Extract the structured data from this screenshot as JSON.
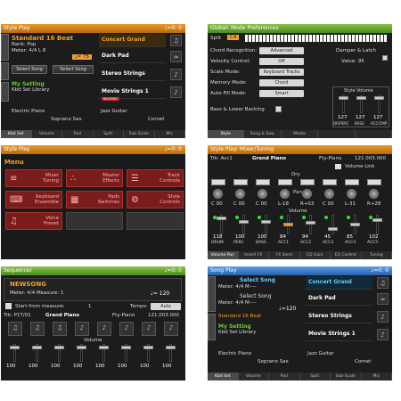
{
  "p1": {
    "header_left": "Style Play",
    "header_right": "♩=0: 0",
    "style_name": "Standard 16 Beat",
    "style_sub": "Bank: Pop",
    "meter": "Meter: 4/4 L  8",
    "tempo": "♩= 75",
    "select_song_1": "Select Song",
    "select_song_2": "Select Song",
    "my_setting": "My Setting",
    "kbd_lib": "Kbd Set Library",
    "sounds": [
      "Concert Grand",
      "Dark Pad",
      "Stereo Strings",
      "Movie Strings 1"
    ],
    "backing_badge": "BACKING",
    "bottom_labels": [
      "Electric Piano",
      "Jazz Guitar",
      "Soprano Sax",
      "Cornet"
    ],
    "tabs": [
      "Kbd Set",
      "Volume",
      "Pad",
      "Split",
      "Sub-Scale",
      "Mic"
    ]
  },
  "p2": {
    "header_left": "Global: Mode Preferences",
    "split_label": "Split",
    "split_value": "C4",
    "rows": [
      {
        "label": "Chord Recognition:",
        "value": "Advanced"
      },
      {
        "label": "Velocity Control:",
        "value": "Off"
      },
      {
        "label": "Scale Mode:",
        "value": "Keyboard Tracks"
      },
      {
        "label": "Memory Mode:",
        "value": "Chord"
      },
      {
        "label": "Auto Fill Mode:",
        "value": "Smart"
      }
    ],
    "damper": "Damper & Latch",
    "value_label": "Value: 95",
    "bass_lower": "Bass & Lower Backing",
    "style_volume": "Style Volume",
    "vol_values": [
      "127",
      "127",
      "127"
    ],
    "vol_labels": [
      "DR/PERC",
      "BASS",
      "ACC/CMP"
    ],
    "tabs": [
      "Style",
      "Song & Seq.",
      "Media"
    ]
  },
  "p3": {
    "header_left": "Style Play",
    "header_right": "♩=0: 0",
    "menu_title": "Menu",
    "items": [
      "Mixer Tuning",
      "Master Effects",
      "Track Controls",
      "Keyboard Ensemble",
      "Pads Switches",
      "Style Controls",
      "Voice Preset"
    ]
  },
  "p4": {
    "header_left": "Style Play: Mixer/Tuning",
    "trk": "Trk: Acc1",
    "sound": "Grand Piano",
    "bank": "Fty-Piano",
    "num": "121.003.000",
    "volume_link": "Volume Link",
    "drys": [
      "Dry",
      "Pan",
      "Volume"
    ],
    "pan_values": [
      "C 00",
      "C 00",
      "C 00",
      "L-18",
      "R+03",
      "C 00",
      "L-31",
      "R+28"
    ],
    "volumes": [
      "118",
      "100",
      "100",
      "84",
      "94",
      "45",
      "85",
      "102"
    ],
    "channels": [
      "DRUM",
      "PERC",
      "BASS",
      "ACC1",
      "ACC2",
      "ACC3",
      "ACC4",
      "ACC5"
    ],
    "tabs": [
      "Volume Pan",
      "Insert FX",
      "FX Send",
      "EQ Gain",
      "EQ Control",
      "Tuning"
    ]
  },
  "p5": {
    "header_left": "Sequencer",
    "header_right": "♩=0: 0",
    "song_name": "NEWSONG",
    "meter": "Meter: 4/4   Measure:  1",
    "tempo_display": "♩= 120",
    "start_from": "Start from measure:",
    "start_val": "1",
    "tempo_label": "Tempo:",
    "tempo_mode": "Auto",
    "trk": "Trk: P1T/01",
    "sound": "Grand Piano",
    "bank": "Fty-Piano",
    "num": "121.003.000",
    "volume": "Volume",
    "vol_values": [
      "100",
      "100",
      "100",
      "100",
      "100",
      "100",
      "100",
      "100"
    ]
  },
  "p6": {
    "header_left": "Song Play",
    "header_right": "♩=0: 0",
    "select_song_1": "Select Song",
    "meter1": "Meter: 4/4   M----",
    "select_song_2": "Select Song",
    "meter2": "Meter: 4/4   M----",
    "tempo": "♩=120",
    "style_name": "Standard 16 Beat",
    "my_setting": "My Setting",
    "kbd_lib": "Kbd Set Library",
    "sounds": [
      "Concert Grand",
      "Dark Pad",
      "Stereo Strings",
      "Movie Strings 1"
    ],
    "bottom_labels": [
      "Electric Piano",
      "Jazz Guitar",
      "Soprano Sax",
      "Cornet"
    ],
    "tabs": [
      "Kbd Set",
      "Volume",
      "Pad",
      "Split",
      "Sub-Scale",
      "Mic"
    ]
  }
}
